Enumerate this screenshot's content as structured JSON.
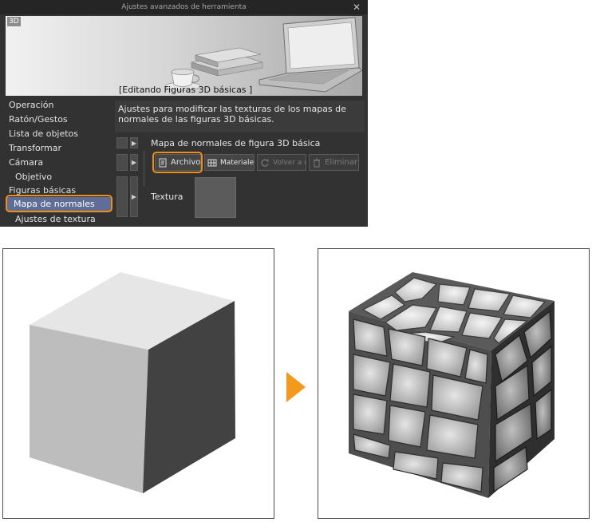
{
  "window": {
    "title": "Ajustes avanzados de herramienta",
    "close_glyph": "✕"
  },
  "preview": {
    "badge": "3D",
    "caption": "[Editando Figuras 3D básicas ]"
  },
  "categories": [
    {
      "label": "Operación",
      "level": 0
    },
    {
      "label": "Ratón/Gestos",
      "level": 0
    },
    {
      "label": "Lista de objetos",
      "level": 0
    },
    {
      "label": "Transformar",
      "level": 0
    },
    {
      "label": "Cámara",
      "level": 0
    },
    {
      "label": "Objetivo",
      "level": 1
    },
    {
      "label": "Figuras básicas",
      "level": 0
    },
    {
      "label": "Mapa de normales",
      "level": 1,
      "selected": true
    },
    {
      "label": "Ajustes de textura",
      "level": 1
    }
  ],
  "description": {
    "line1": "Ajustes para modificar las texturas de los mapas de",
    "line2": "normales de las figuras 3D básicas."
  },
  "settings": {
    "section_label": "Mapa de normales de figura 3D básica",
    "buttons": {
      "archivo": {
        "label": "Archivo",
        "icon": "file-icon"
      },
      "materiales": {
        "label": "Materiales",
        "icon": "grid-icon"
      },
      "volver": {
        "label": "Volver a c",
        "icon": "reset-icon",
        "disabled": true
      },
      "eliminar": {
        "label": "Eliminar",
        "icon": "trash-icon",
        "disabled": true
      }
    },
    "texture_label": "Textura",
    "arrow_glyph": "▶"
  },
  "colors": {
    "highlight": "#f08c1a",
    "selection": "#5e6e96",
    "dialog_bg": "#323232"
  }
}
